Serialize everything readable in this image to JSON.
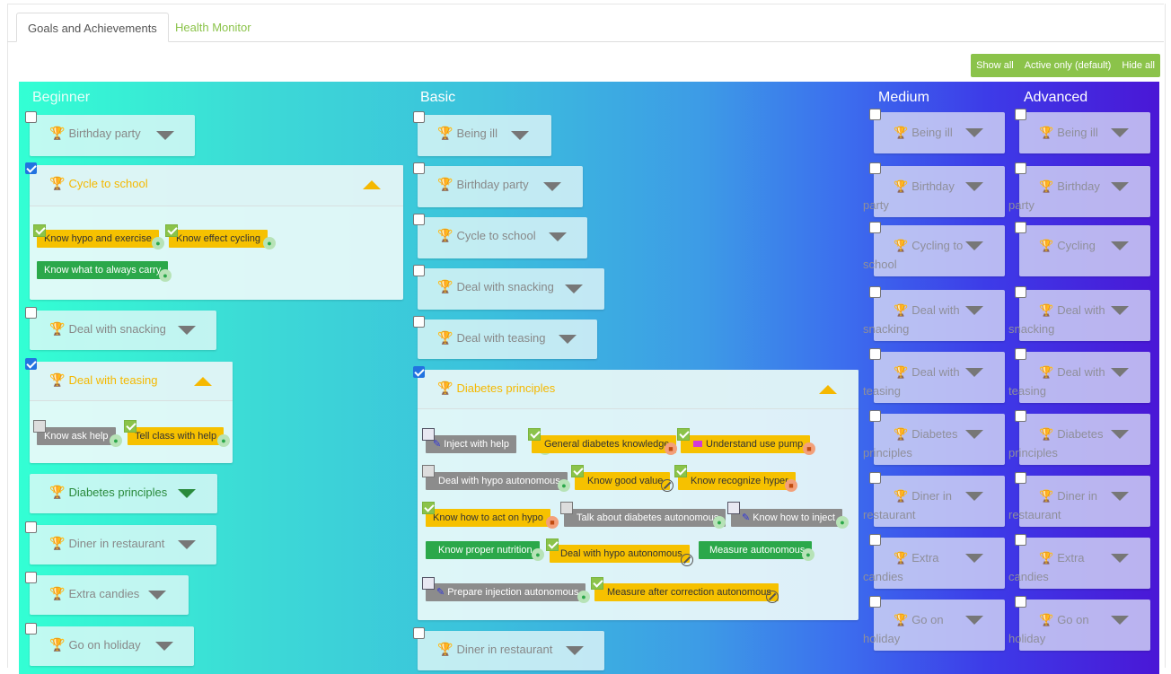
{
  "tabs": [
    "Goals and Achievements",
    "Health Monitor"
  ],
  "toggles": [
    "Show all",
    "Active only (default)",
    "Hide all"
  ],
  "columns": [
    "Beginner",
    "Basic",
    "Medium",
    "Advanced"
  ],
  "beginner": [
    {
      "label": "Birthday party"
    },
    {
      "label": "Cycle to school",
      "skills": [
        "Know hypo and exercise",
        "Know effect cycling",
        "Know what to always carry"
      ]
    },
    {
      "label": "Deal with snacking"
    },
    {
      "label": "Deal with teasing",
      "skills": [
        "Know ask help",
        "Tell class with help"
      ]
    },
    {
      "label": "Diabetes principles"
    },
    {
      "label": "Diner in restaurant"
    },
    {
      "label": "Extra candies"
    },
    {
      "label": "Go on holiday"
    }
  ],
  "basic": [
    {
      "label": "Being ill"
    },
    {
      "label": "Birthday party"
    },
    {
      "label": "Cycle to school"
    },
    {
      "label": "Deal with snacking"
    },
    {
      "label": "Deal with teasing"
    },
    {
      "label": "Diabetes principles",
      "skills": [
        "Inject with help",
        "General diabetes knowledge",
        "Understand use pump",
        "Deal with hypo autonomous",
        "Know good value",
        "Know recognize hyper",
        "Know how to act on hypo",
        "Talk about diabetes autonomous",
        "Know how to inject",
        "Know proper nutrition",
        "Deal with hypo autonomous",
        "Measure autonomous",
        "Prepare injection autonomous",
        "Measure after correction autonomous"
      ]
    },
    {
      "label": "Diner in restaurant"
    }
  ],
  "medium": [
    {
      "l1": "Being ill",
      "l2": ""
    },
    {
      "l1": "Birthday",
      "l2": "party"
    },
    {
      "l1": "Cycling to",
      "l2": "school"
    },
    {
      "l1": "Deal with",
      "l2": "snacking"
    },
    {
      "l1": "Deal with",
      "l2": "teasing"
    },
    {
      "l1": "Diabetes",
      "l2": "principles"
    },
    {
      "l1": "Diner in",
      "l2": "restaurant"
    },
    {
      "l1": "Extra",
      "l2": "candies"
    },
    {
      "l1": "Go on",
      "l2": "holiday"
    }
  ],
  "advanced": [
    {
      "l1": "Being ill",
      "l2": ""
    },
    {
      "l1": "Birthday",
      "l2": "party"
    },
    {
      "l1": "Cycling",
      "l2": ""
    },
    {
      "l1": "Deal with",
      "l2": "snacking"
    },
    {
      "l1": "Deal with",
      "l2": "teasing"
    },
    {
      "l1": "Diabetes",
      "l2": "principles"
    },
    {
      "l1": "Diner in",
      "l2": "restaurant"
    },
    {
      "l1": "Extra",
      "l2": "candies"
    },
    {
      "l1": "Go on",
      "l2": "holiday"
    }
  ],
  "colors": {
    "accent": "#8bc34a",
    "goal_open": "#f5b800",
    "chip_yellow": "#f6c100",
    "chip_green": "#2ba84a",
    "chip_gray": "#8c8c8c"
  }
}
